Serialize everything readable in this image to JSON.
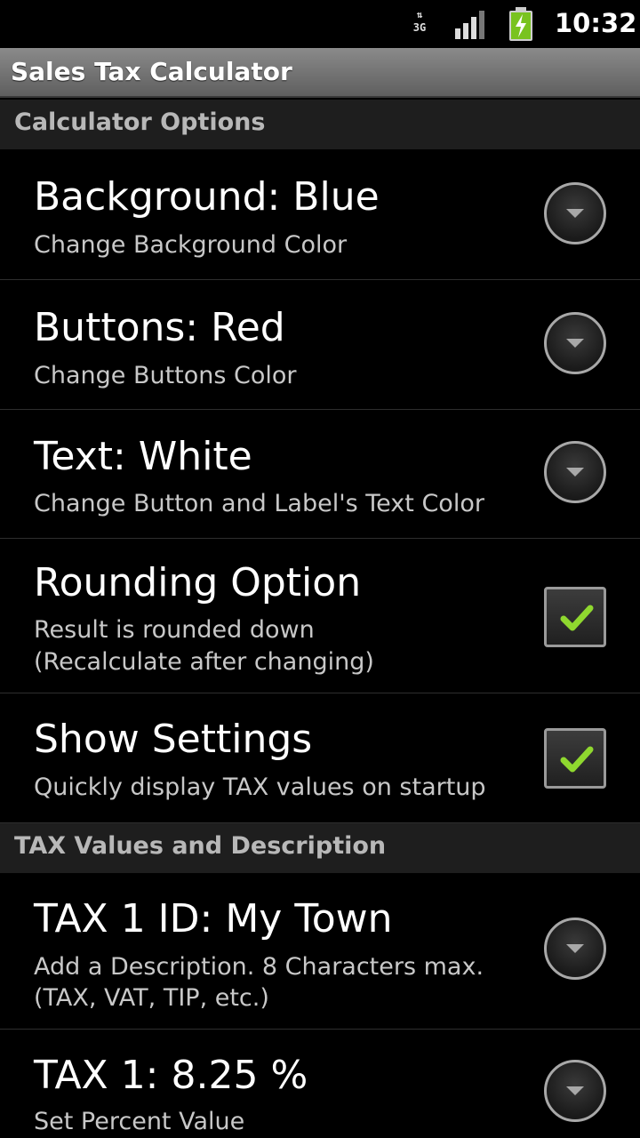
{
  "status_bar": {
    "network": "3G",
    "time": "10:32"
  },
  "app_bar": {
    "title": "Sales Tax Calculator"
  },
  "sections": [
    {
      "header": "Calculator Options",
      "items": [
        {
          "title": "Background:  Blue",
          "summary": "Change Background Color",
          "widget": "dropdown"
        },
        {
          "title": "Buttons:  Red",
          "summary": "Change Buttons Color",
          "widget": "dropdown"
        },
        {
          "title": "Text:  White",
          "summary": "Change Button and Label's Text Color",
          "widget": "dropdown"
        },
        {
          "title": "Rounding Option",
          "summary": "Result is rounded down",
          "summary2": "(Recalculate after changing)",
          "widget": "checkbox",
          "checked": true
        },
        {
          "title": "Show Settings",
          "summary": "Quickly display TAX values on startup",
          "widget": "checkbox",
          "checked": true
        }
      ]
    },
    {
      "header": "TAX Values and Description",
      "items": [
        {
          "title": "TAX 1 ID:  My Town",
          "summary": "Add a Description. 8 Characters max.",
          "summary2": "(TAX, VAT, TIP, etc.)",
          "widget": "dropdown"
        },
        {
          "title": "TAX 1: 8.25 %",
          "summary": "Set Percent Value",
          "widget": "dropdown"
        }
      ]
    }
  ],
  "colors": {
    "check": "#8fd82f",
    "title_bar": "#7a7a7a",
    "category_bg": "#1e1e1e"
  }
}
